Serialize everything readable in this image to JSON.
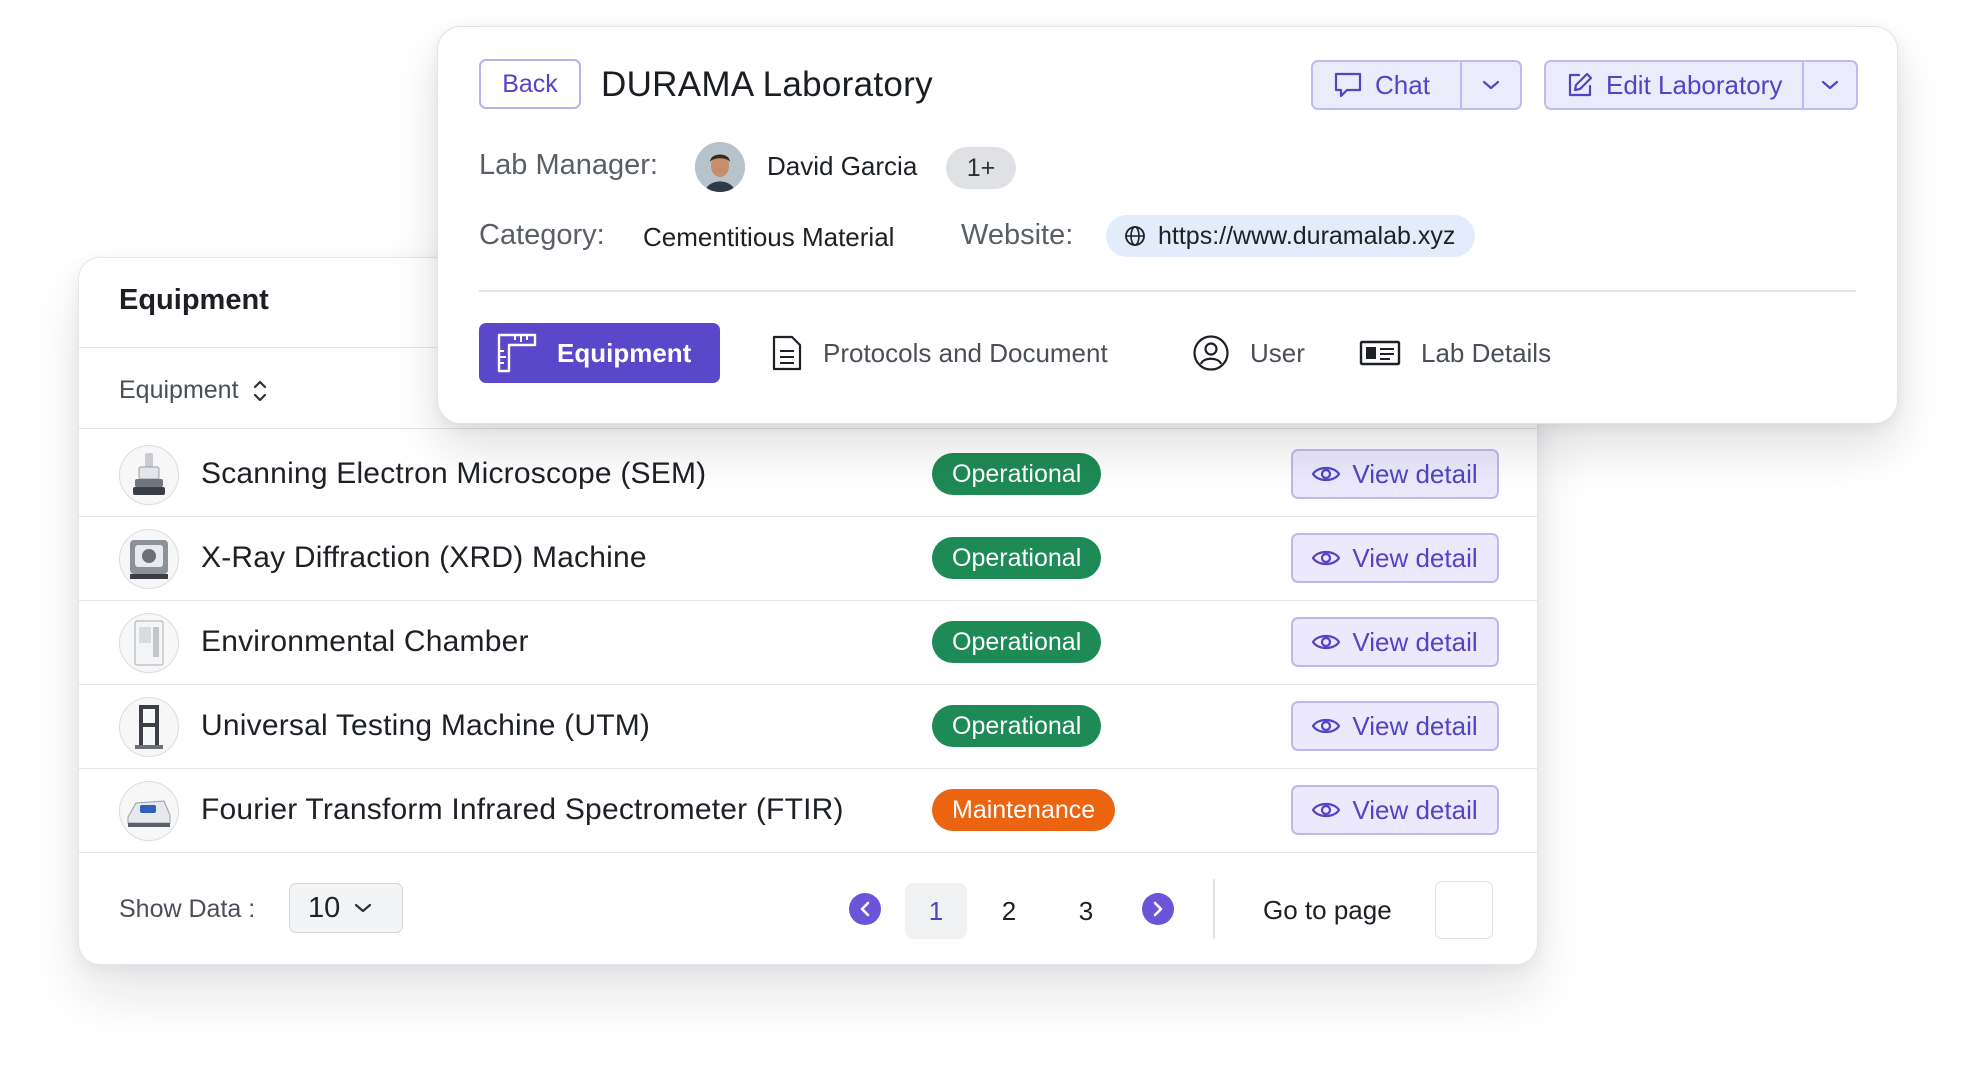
{
  "lab": {
    "back_label": "Back",
    "title": "DURAMA Laboratory",
    "chat_label": "Chat",
    "edit_label": "Edit Laboratory",
    "manager_label": "Lab Manager:",
    "manager_name": "David Garcia",
    "more_count": "1+",
    "category_label": "Category:",
    "category_value": "Cementitious Material",
    "website_label": "Website:",
    "website_value": "https://www.duramalab.xyz",
    "tabs": [
      {
        "label": "Equipment",
        "icon": "ruler-icon",
        "active": true
      },
      {
        "label": "Protocols and Document",
        "icon": "document-icon",
        "active": false
      },
      {
        "label": "User",
        "icon": "user-circle-icon",
        "active": false
      },
      {
        "label": "Lab Details",
        "icon": "id-card-icon",
        "active": false
      }
    ]
  },
  "equipment": {
    "title": "Equipment",
    "column_header": "Equipment",
    "view_label": "View detail",
    "colors": {
      "operational": "#1e8a55",
      "maintenance": "#ec6410",
      "accent": "#5b47c9"
    },
    "rows": [
      {
        "name": "Scanning Electron Microscope (SEM)",
        "status": "Operational"
      },
      {
        "name": "X-Ray Diffraction (XRD) Machine",
        "status": "Operational"
      },
      {
        "name": "Environmental Chamber",
        "status": "Operational"
      },
      {
        "name": "Universal Testing Machine (UTM)",
        "status": "Operational"
      },
      {
        "name": "Fourier Transform Infrared Spectrometer (FTIR)",
        "status": "Maintenance"
      }
    ]
  },
  "pagination": {
    "show_label": "Show Data :",
    "page_size": "10",
    "pages": [
      "1",
      "2",
      "3"
    ],
    "current_page": "1",
    "goto_label": "Go to page"
  }
}
